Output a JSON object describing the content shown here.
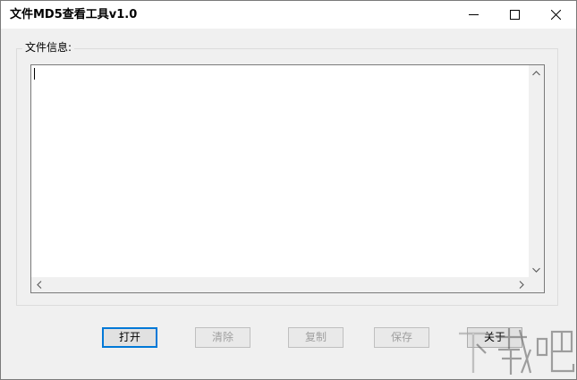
{
  "window": {
    "title": "文件MD5查看工具v1.0"
  },
  "group": {
    "label": "文件信息:"
  },
  "textarea": {
    "value": ""
  },
  "buttons": {
    "open": "打开",
    "clear": "清除",
    "copy": "复制",
    "save": "保存",
    "about": "关于"
  },
  "icons": {
    "minimize": "minimize-icon",
    "maximize": "maximize-icon",
    "close": "close-icon",
    "scroll_up": "chevron-up-icon",
    "scroll_down": "chevron-down-icon",
    "scroll_left": "chevron-left-icon",
    "scroll_right": "chevron-right-icon"
  },
  "watermark": {
    "text": "下载吧"
  }
}
